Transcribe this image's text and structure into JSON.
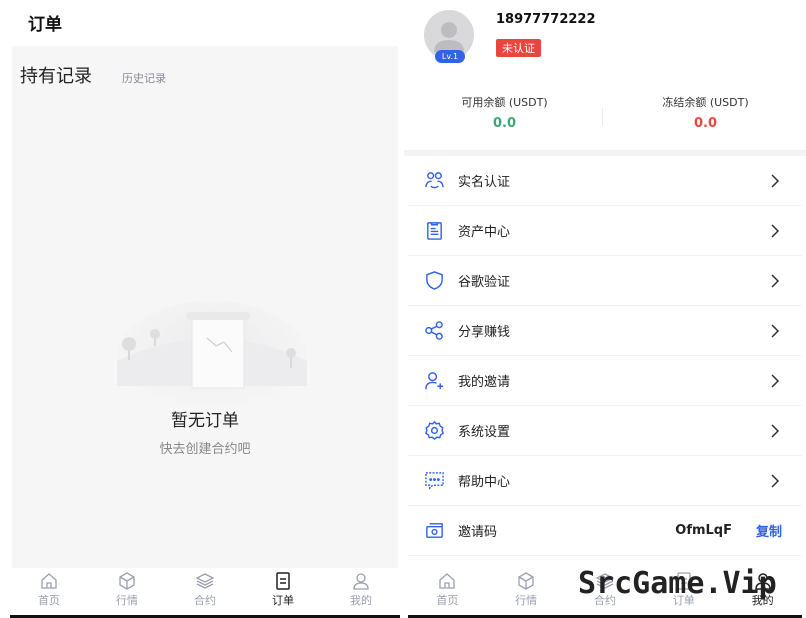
{
  "left": {
    "header_title": "订单",
    "tabs": {
      "holding": "持有记录",
      "history": "历史记录"
    },
    "empty": {
      "title": "暂无订单",
      "subtitle": "快去创建合约吧"
    }
  },
  "right": {
    "profile": {
      "phone": "18977772222",
      "level": "Lv.1",
      "status": "未认证"
    },
    "balances": [
      {
        "label": "可用余额 (USDT)",
        "value": "0.0",
        "color": "#3aa876"
      },
      {
        "label": "冻结余额 (USDT)",
        "value": "0.0",
        "color": "#e8473f"
      }
    ],
    "menu": [
      {
        "label": "实名认证",
        "icon": "users-icon"
      },
      {
        "label": "资产中心",
        "icon": "clipboard-icon"
      },
      {
        "label": "谷歌验证",
        "icon": "shield-icon"
      },
      {
        "label": "分享赚钱",
        "icon": "share-icon"
      },
      {
        "label": "我的邀请",
        "icon": "user-plus-icon"
      },
      {
        "label": "系统设置",
        "icon": "gear-icon"
      },
      {
        "label": "帮助中心",
        "icon": "help-chat-icon"
      },
      {
        "label": "邀请码",
        "icon": "ticket-icon",
        "value": "OfmLqF",
        "action": "复制"
      }
    ]
  },
  "tabbar": {
    "items": [
      {
        "label": "首页",
        "icon": "home-icon"
      },
      {
        "label": "行情",
        "icon": "cube-icon"
      },
      {
        "label": "合约",
        "icon": "layers-icon"
      },
      {
        "label": "订单",
        "icon": "order-icon"
      },
      {
        "label": "我的",
        "icon": "person-icon"
      }
    ],
    "left_active": 3,
    "right_active": 4
  },
  "watermark": "SrcGame.Vip",
  "colors": {
    "accent": "#3262e8",
    "green": "#3aa876",
    "red": "#e8473f"
  }
}
